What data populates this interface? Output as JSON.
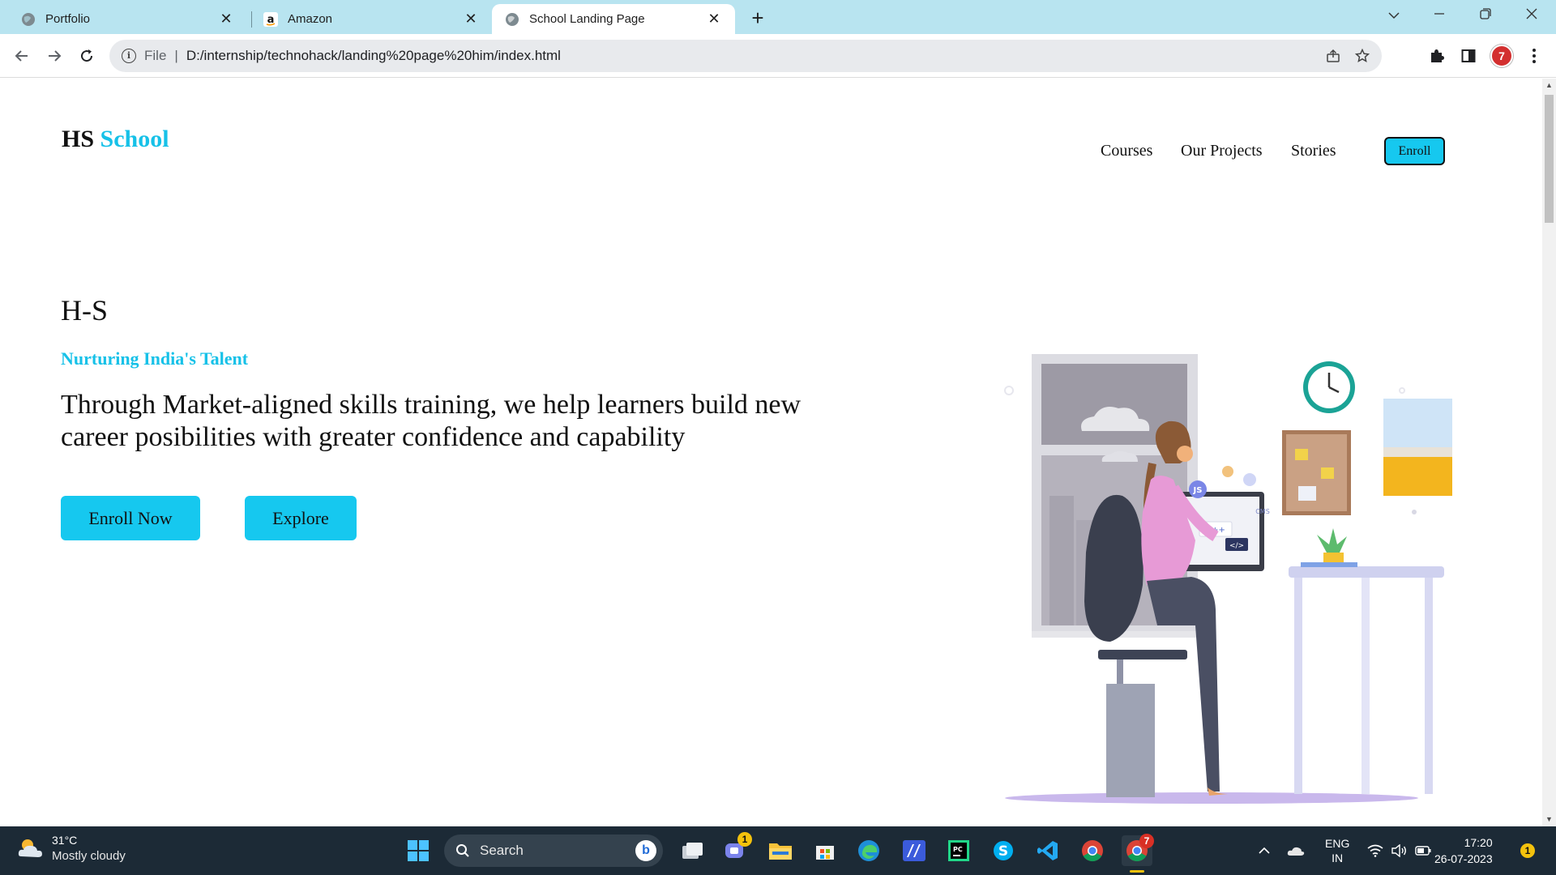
{
  "browser": {
    "tabs": [
      {
        "title": "Portfolio",
        "icon": "globe-icon"
      },
      {
        "title": "Amazon",
        "icon": "amazon-icon"
      },
      {
        "title": "School Landing Page",
        "icon": "globe-icon",
        "active": true
      }
    ],
    "address": {
      "scheme": "File",
      "url": "D:/internship/technohack/landing%20page%20him/index.html"
    },
    "profile_badge": "7"
  },
  "page": {
    "logo": {
      "part1": "HS",
      "part2": "School"
    },
    "nav": [
      "Courses",
      "Our Projects",
      "Stories"
    ],
    "nav_enroll": "Enroll",
    "hero": {
      "title": "H-S",
      "subtitle": "Nurturing India's Talent",
      "text": "Through Market-aligned skills training, we help learners build new career posibilities with greater confidence and capability",
      "buttons": [
        "Enroll Now",
        "Explore"
      ]
    },
    "illustration": {
      "screen_tags": [
        "C++",
        "</>",
        "JS",
        "CMS"
      ]
    },
    "accent_color": "#16c1e8",
    "button_color": "#16c8ef"
  },
  "taskbar": {
    "weather": {
      "temp": "31°C",
      "condition": "Mostly cloudy"
    },
    "search_placeholder": "Search",
    "teams_badge": "1",
    "chrome_badge": "7",
    "language": {
      "line1": "ENG",
      "line2": "IN"
    },
    "time": "17:20",
    "date": "26-07-2023",
    "notification_count": "1"
  }
}
